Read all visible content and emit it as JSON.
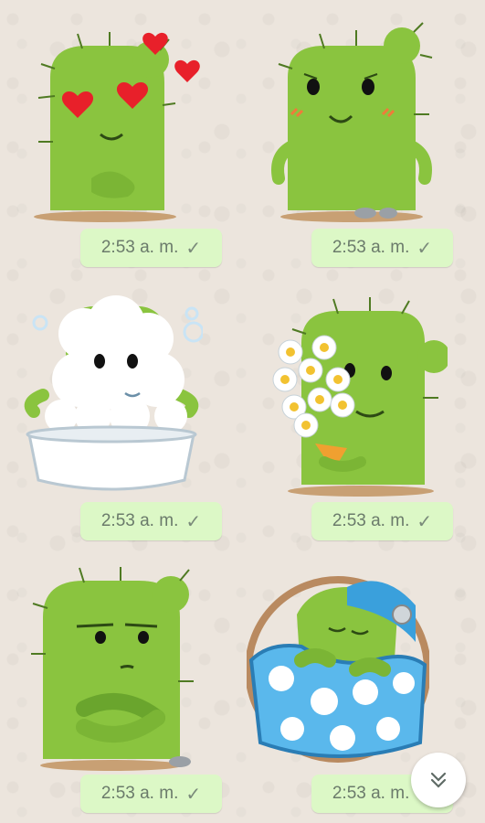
{
  "messages": [
    {
      "sticker": "cactus-heart-eyes",
      "time": "2:53 a. m.",
      "status_icon": "check"
    },
    {
      "sticker": "cactus-blushing",
      "time": "2:53 a. m.",
      "status_icon": "check"
    },
    {
      "sticker": "cactus-bubble-bath",
      "time": "2:53 a. m.",
      "status_icon": "check"
    },
    {
      "sticker": "cactus-flowers",
      "time": "2:53 a. m.",
      "status_icon": "check"
    },
    {
      "sticker": "cactus-arms-crossed",
      "time": "2:53 a. m.",
      "status_icon": "check"
    },
    {
      "sticker": "cactus-egg-sleeping",
      "time": "2:53 a. m.",
      "status_icon": "check"
    }
  ],
  "colors": {
    "background": "#ece5dd",
    "bubble": "#dcf8c6",
    "cactus": "#8ac43f",
    "cactus_dark": "#6aa52d"
  },
  "scroll_button_icon": "double-chevron-down-icon"
}
